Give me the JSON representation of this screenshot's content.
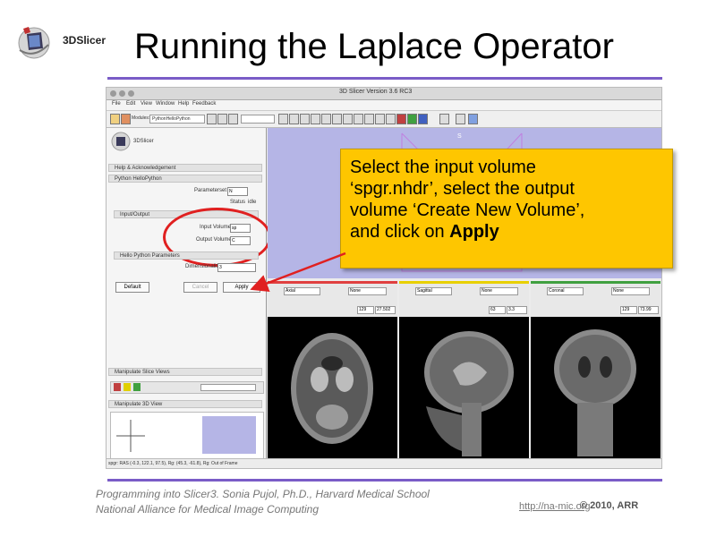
{
  "slide": {
    "logo_text": "3DSlicer",
    "title": "Running the Laplace Operator",
    "footer_line1": "Programming into Slicer3. Sonia Pujol, Ph.D., Harvard Medical School",
    "footer_line2": "National Alliance for Medical Image Computing",
    "footer_url": "http://na-mic.org",
    "footer_copy": "© 2010, ARR",
    "accent_color": "#7a5cc7"
  },
  "app": {
    "window_title": "3D Slicer Version 3.6 RC3",
    "menus": [
      "File",
      "Edit",
      "View",
      "Window",
      "Help",
      "Feedback"
    ],
    "modules_label": "Modules:",
    "module_selected": "PythonHelloPython",
    "search_placeholder": "",
    "panel_logo": "3DSlicer",
    "sections": {
      "help": "Help & Acknowledgement",
      "module": "Python HelloPython",
      "io": "Input/Output",
      "params": "Hello Python Parameters",
      "slice_views": "Manipulate Slice Views",
      "view3d": "Manipulate 3D View"
    },
    "parameter_set_label": "Parameterset",
    "parameter_set_value": "N",
    "status_label": "Status",
    "status_value": "idle",
    "input_volume_label": "Input Volume",
    "input_volume_value": "sp",
    "output_volume_label": "Output Volume",
    "output_volume_value": "C",
    "dimensionality_label": "Dimensionality",
    "dimensionality_value": "3",
    "default_button": "Default",
    "cancel_button": "Cancel",
    "apply_button": "Apply",
    "view3d_label": "S",
    "slices": [
      {
        "orientation": "Axial",
        "color": "#e04040",
        "layer": "None",
        "index": "129",
        "value": "27.502"
      },
      {
        "orientation": "Sagittal",
        "color": "#e8d000",
        "layer": "None",
        "index": "63",
        "value": "3.3"
      },
      {
        "orientation": "Coronal",
        "color": "#40a040",
        "layer": "None",
        "index": "129",
        "value": "73.99"
      }
    ],
    "status_bar": "spgr: RAS (-0.3, 122.1, 97.5), Rg: (45.3, -61.8), Rg: Out of Frame"
  },
  "callout": {
    "line1": "Select the input volume",
    "line2": "‘spgr.nhdr’, select the output",
    "line3": "volume ‘Create New Volume’,",
    "line4_prefix": "and click on ",
    "line4_bold": "Apply"
  },
  "colors": {
    "callout_bg": "#fec600",
    "highlight": "#e02020",
    "view3d_bg": "#b5b5e6"
  }
}
